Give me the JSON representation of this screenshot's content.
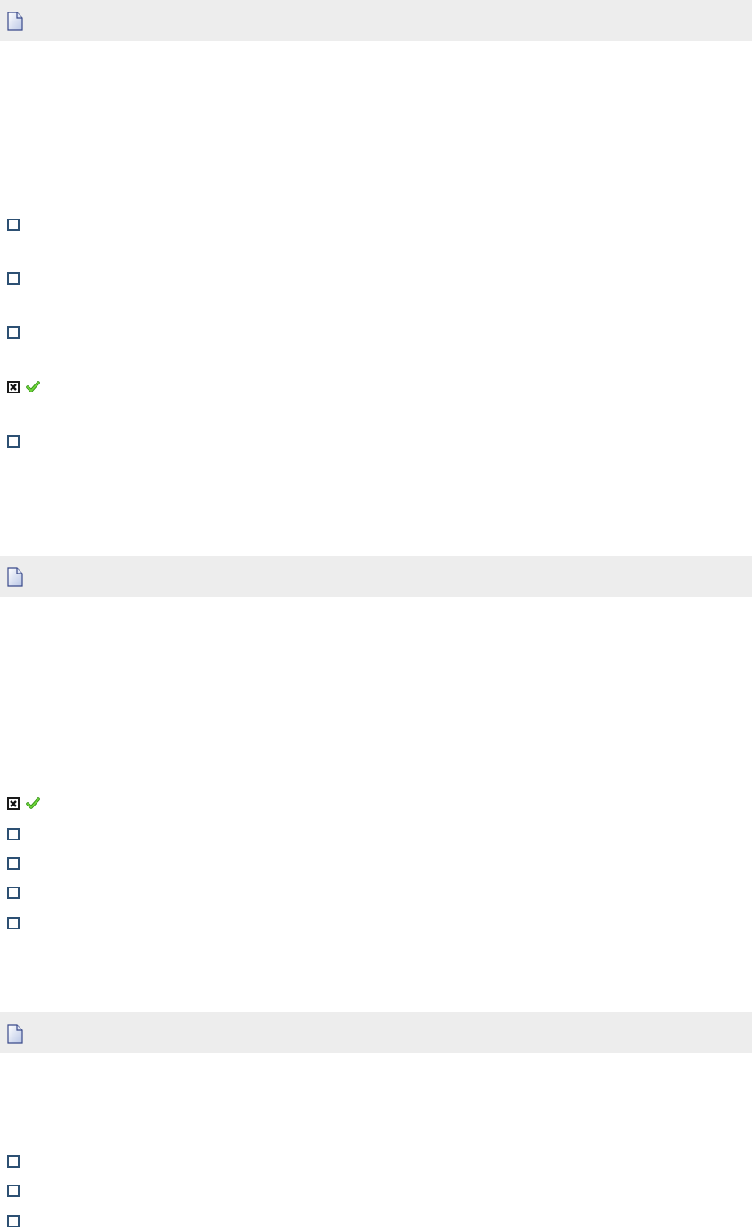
{
  "colors": {
    "question_bar_bg": "#ededed",
    "checkbox_border": "#2d5073",
    "correct_check": "#4fbf1f"
  },
  "questions": [
    {
      "icon": "page-icon",
      "options": [
        {
          "checked": false,
          "correct": false
        },
        {
          "checked": false,
          "correct": false
        },
        {
          "checked": false,
          "correct": false
        },
        {
          "checked": true,
          "correct": true
        },
        {
          "checked": false,
          "correct": false
        }
      ]
    },
    {
      "icon": "page-icon",
      "options": [
        {
          "checked": true,
          "correct": true
        },
        {
          "checked": false,
          "correct": false
        },
        {
          "checked": false,
          "correct": false
        },
        {
          "checked": false,
          "correct": false
        },
        {
          "checked": false,
          "correct": false
        }
      ]
    },
    {
      "icon": "page-icon",
      "options": [
        {
          "checked": false,
          "correct": false
        },
        {
          "checked": false,
          "correct": false
        },
        {
          "checked": false,
          "correct": false
        }
      ]
    }
  ]
}
